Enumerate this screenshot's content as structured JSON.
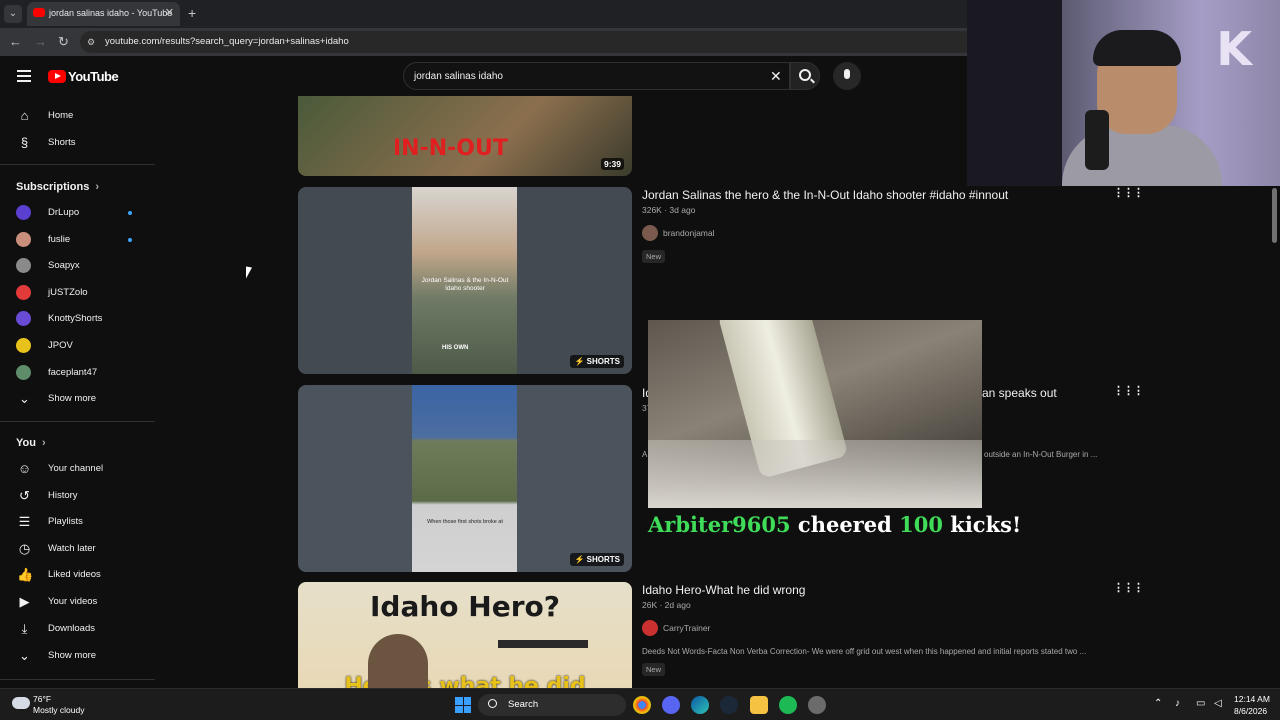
{
  "browser": {
    "tab_title": "jordan salinas idaho - YouTube",
    "tab_close": "✕",
    "new_tab": "+",
    "url": "youtube.com/results?search_query=jordan+salinas+idaho",
    "nav": {
      "back": "←",
      "forward": "→",
      "reload": "↻"
    }
  },
  "masthead": {
    "logo_text": "YouTube",
    "search_value": "jordan salinas idaho",
    "clear_icon": "✕"
  },
  "sidebar": {
    "main": [
      {
        "label": "Home",
        "icon": "home-icon",
        "glyph": "⌂"
      },
      {
        "label": "Shorts",
        "icon": "shorts-icon",
        "glyph": "§"
      }
    ],
    "subscriptions_heading": "Subscriptions",
    "subscriptions": [
      {
        "label": "DrLupo",
        "color": "#5b3fd1",
        "live": true
      },
      {
        "label": "fuslie",
        "color": "#c98f7a",
        "live": true
      },
      {
        "label": "Soapyx",
        "color": "#8a8a8a",
        "live": false
      },
      {
        "label": "jUSTZolo",
        "color": "#e23a3a",
        "live": false
      },
      {
        "label": "KnottyShorts",
        "color": "#6a4bd6",
        "live": false
      },
      {
        "label": "JPOV",
        "color": "#e8c21a",
        "live": false
      },
      {
        "label": "faceplant47",
        "color": "#5f8d6a",
        "live": false
      }
    ],
    "show_more_1": "Show more",
    "you_heading": "You",
    "you": [
      {
        "label": "Your channel",
        "icon": "channel-icon",
        "glyph": "☺"
      },
      {
        "label": "History",
        "icon": "history-icon",
        "glyph": "↺"
      },
      {
        "label": "Playlists",
        "icon": "playlists-icon",
        "glyph": "☰"
      },
      {
        "label": "Watch later",
        "icon": "watch-later-icon",
        "glyph": "◷"
      },
      {
        "label": "Liked videos",
        "icon": "like-icon",
        "glyph": "👍"
      },
      {
        "label": "Your videos",
        "icon": "your-videos-icon",
        "glyph": "▶"
      },
      {
        "label": "Downloads",
        "icon": "download-icon",
        "glyph": "⤓"
      }
    ],
    "show_more_2": "Show more"
  },
  "results": [
    {
      "duration": "9:39",
      "thumb_text": "IN-N-OUT"
    },
    {
      "title": "Jordan Salinas the hero & the In-N-Out Idaho shooter #idaho #innout",
      "meta": "326K · 3d ago",
      "channel": "brandonjamal",
      "badge": "New",
      "shorts": "SHORTS",
      "thumb_caption": "Jordan Salinas & the In-N-Out Idaho shooter",
      "thumb_caption2": "HIS OWN"
    },
    {
      "title_left": "Id",
      "title_right": "an speaks out",
      "meta": "37",
      "desc_left": "A",
      "desc_right": "outside an In-N-Out Burger in ...",
      "shorts": "SHORTS",
      "thumb_caption": "When those first shots broke at"
    },
    {
      "title": "Idaho Hero-What he did wrong",
      "meta": "26K · 2d ago",
      "channel": "CarryTrainer",
      "desc": "Deeds Not Words-Facta Non Verba Correction- We were off grid out west when this happened and initial reports stated two ...",
      "badge": "New",
      "thumb_title": "Idaho Hero?",
      "thumb_sub": "Here is what he did"
    }
  ],
  "alert": {
    "user": "Arbiter9605",
    "verb": "cheered",
    "amount": "100",
    "unit": "kicks!"
  },
  "webcam": {
    "letter": "K"
  },
  "taskbar": {
    "temp": "76°F",
    "condition": "Mostly cloudy",
    "search": "Search",
    "time": "12:14 AM",
    "date": "8/6/2026"
  },
  "colors": {
    "accent": "#ff0000",
    "link": "#3ea6ff",
    "alert_green": "#3fdc59"
  }
}
